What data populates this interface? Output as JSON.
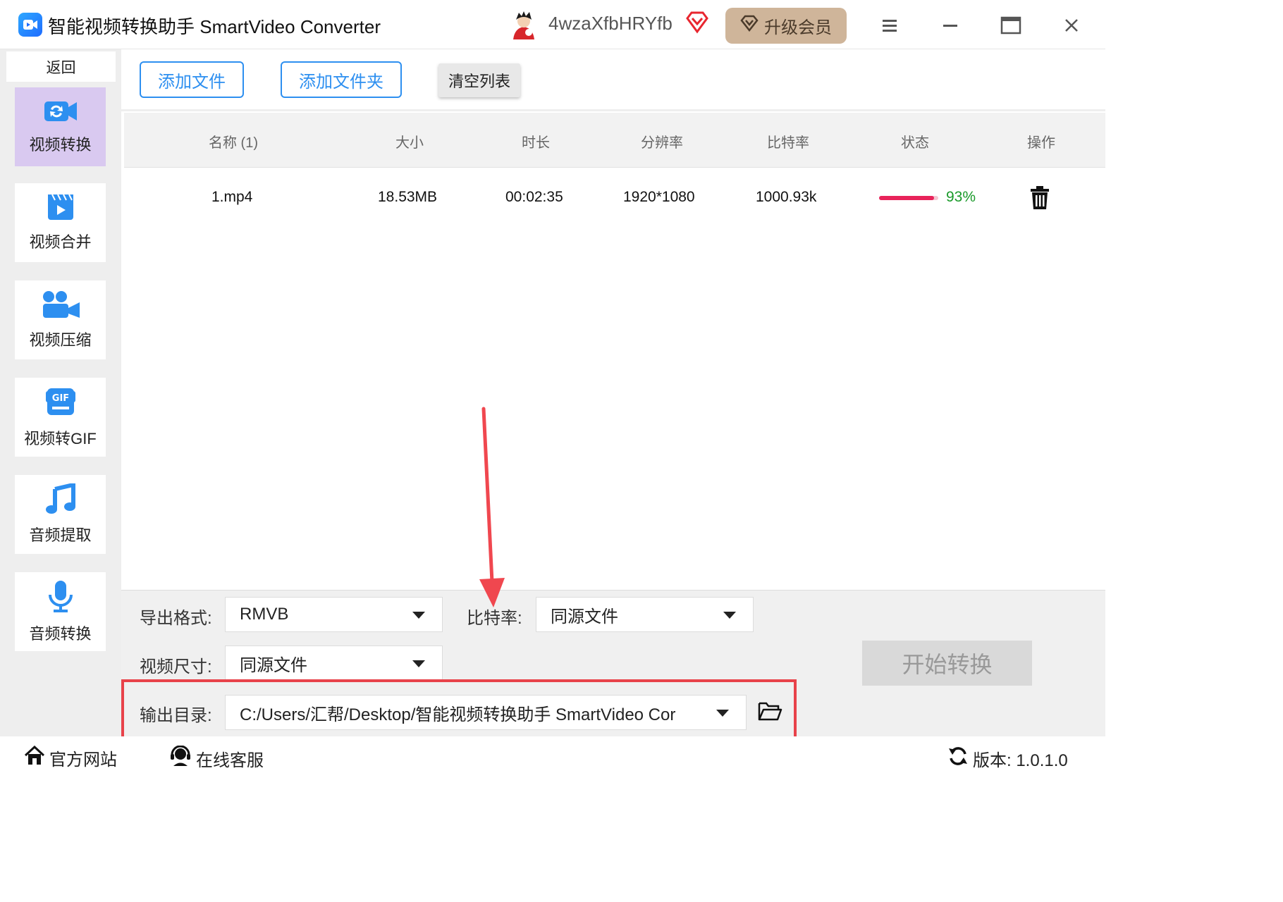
{
  "app": {
    "title": "智能视频转换助手 SmartVideo Converter",
    "username": "4wzaXfbHRYfb",
    "upgrade_label": "升级会员"
  },
  "sidebar": {
    "back_label": "返回",
    "items": [
      {
        "label": "视频转换",
        "icon": "video-convert-icon",
        "active": true
      },
      {
        "label": "视频合并",
        "icon": "video-merge-icon"
      },
      {
        "label": "视频压缩",
        "icon": "video-compress-icon"
      },
      {
        "label": "视频转GIF",
        "icon": "gif-icon"
      },
      {
        "label": "音频提取",
        "icon": "music-note-icon"
      },
      {
        "label": "音频转换",
        "icon": "microphone-icon"
      }
    ]
  },
  "toolbar": {
    "add_file": "添加文件",
    "add_folder": "添加文件夹",
    "clear_list": "清空列表"
  },
  "table": {
    "headers": [
      "名称 (1)",
      "大小",
      "时长",
      "分辨率",
      "比特率",
      "状态",
      "操作"
    ],
    "rows": [
      {
        "name": "1.mp4",
        "size": "18.53MB",
        "duration": "00:02:35",
        "resolution": "1920*1080",
        "bitrate": "1000.93k",
        "progress_text": "93%",
        "progress": 0.93
      }
    ]
  },
  "settings": {
    "format_label": "导出格式:",
    "format_value": "RMVB",
    "bitrate_label": "比特率:",
    "bitrate_value": "同源文件",
    "size_label": "视频尺寸:",
    "size_value": "同源文件",
    "output_label": "输出目录:",
    "output_value": "C:/Users/汇帮/Desktop/智能视频转换助手 SmartVideo Cor",
    "start_label": "开始转换"
  },
  "footer": {
    "website": "官方网站",
    "support": "在线客服",
    "version": "版本:  1.0.1.0"
  },
  "colors": {
    "accent": "#2d8ff0",
    "highlight": "#e8424a",
    "progress": "#e8235a",
    "progress_text": "#1a9a2a",
    "upgrade_bg": "#cfb59a",
    "sidebar_active": "#d9c9f0"
  }
}
